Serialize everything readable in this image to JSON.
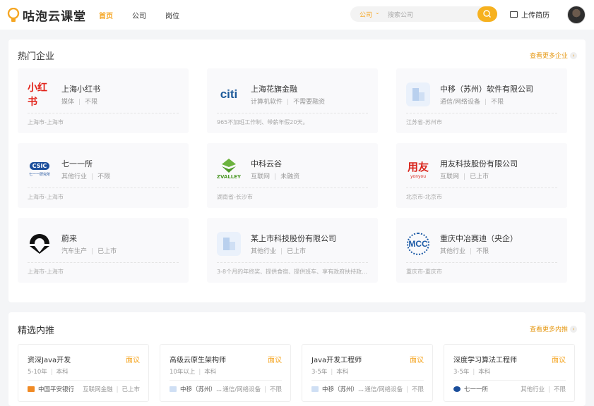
{
  "header": {
    "logo_text": "咕泡云课堂",
    "nav": [
      "首页",
      "公司",
      "岗位"
    ],
    "search_category": "公司",
    "search_placeholder": "搜索公司",
    "upload_label": "上传简历"
  },
  "hot_companies": {
    "title": "热门企业",
    "more_label": "查看更多企业",
    "items": [
      {
        "name": "上海小红书",
        "tags": [
          "媒体",
          "不限"
        ],
        "location": "上海市-上海市"
      },
      {
        "name": "上海花旗金融",
        "tags": [
          "计算机软件",
          "不需要融资"
        ],
        "location": "965不加班工作制、带薪年假20天。"
      },
      {
        "name": "中移（苏州）软件有限公司",
        "tags": [
          "通信/网络设备",
          "不限"
        ],
        "location": "江苏省-苏州市"
      },
      {
        "name": "七一一所",
        "tags": [
          "其他行业",
          "不限"
        ],
        "location": "上海市-上海市"
      },
      {
        "name": "中科云谷",
        "tags": [
          "互联网",
          "未融资"
        ],
        "location": "湖南省-长沙市"
      },
      {
        "name": "用友科技股份有限公司",
        "tags": [
          "互联网",
          "已上市"
        ],
        "location": "北京市-北京市"
      },
      {
        "name": "蔚来",
        "tags": [
          "汽车生产",
          "已上市"
        ],
        "location": "上海市-上海市"
      },
      {
        "name": "某上市科技股份有限公司",
        "tags": [
          "其他行业",
          "已上市"
        ],
        "location": "3-8个月的年终奖、提供食宿、提供班车、享有政府扶持政策..."
      },
      {
        "name": "重庆中冶赛迪（央企）",
        "tags": [
          "其他行业",
          "不限"
        ],
        "location": "重庆市-重庆市"
      }
    ],
    "logo_text": {
      "xhs": "小红书",
      "citi": "citi",
      "csic": "CSIC",
      "csic_sub": "七一一研究所",
      "zvalley": "ZVALLEY",
      "yonyou": "用友",
      "yonyou_sub": "yonyou",
      "mcc": "MCC"
    }
  },
  "recommended_jobs": {
    "title": "精选内推",
    "more_label": "查看更多内推",
    "items": [
      {
        "title": "资深Java开发",
        "salary": "面议",
        "req": [
          "5-10年",
          "本科"
        ],
        "company": "中国平安银行",
        "info": [
          "互联网金融",
          "已上市"
        ]
      },
      {
        "title": "高级云原生架构师",
        "salary": "面议",
        "req": [
          "10年以上",
          "本科"
        ],
        "company": "中移（苏州）...",
        "info": [
          "通信/网络设备",
          "不限"
        ]
      },
      {
        "title": "Java开发工程师",
        "salary": "面议",
        "req": [
          "3-5年",
          "本科"
        ],
        "company": "中移（苏州）...",
        "info": [
          "通信/网络设备",
          "不限"
        ]
      },
      {
        "title": "深度学习算法工程师",
        "salary": "面议",
        "req": [
          "3-5年",
          "本科"
        ],
        "company": "七一一所",
        "info": [
          "其他行业",
          "不限"
        ]
      }
    ]
  },
  "colors": {
    "accent": "#f5a623",
    "background": "#f4f5f7"
  }
}
